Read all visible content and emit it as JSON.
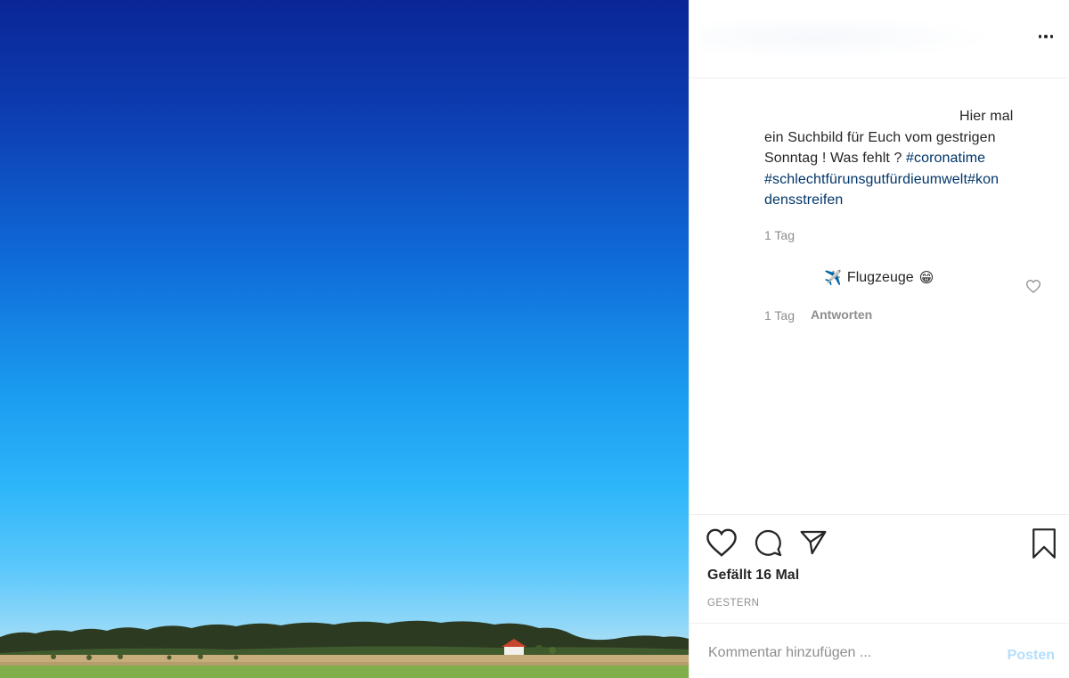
{
  "post": {
    "caption": {
      "text_line1": "Hier mal",
      "text_line2": "ein Suchbild für Euch vom gestrigen",
      "text_line3": "Sonntag ! Was fehlt ? ",
      "hashtag1": "#coronatime",
      "hashtag2": "#schlechtfürunsgutfürdieumwelt",
      "hashtag3": "#kon",
      "hashtag3_cont": "densstreifen",
      "time": "1 Tag"
    },
    "comment": {
      "emoji_airplane": "✈️",
      "text": "Flugzeuge",
      "emoji_grin": "😁",
      "time": "1 Tag",
      "reply_label": "Antworten"
    },
    "likes_label": "Gefällt 16 Mal",
    "date_label": "GESTERN",
    "comment_placeholder": "Kommentar hinzufügen ...",
    "post_button_label": "Posten"
  },
  "icons": {
    "more": "more-options-icon",
    "like": "heart-icon",
    "comment": "comment-icon",
    "share": "share-icon",
    "save": "bookmark-icon"
  },
  "colors": {
    "hashtag": "#003569",
    "muted": "#8e8e8e",
    "post_button": "#b2dffc"
  }
}
